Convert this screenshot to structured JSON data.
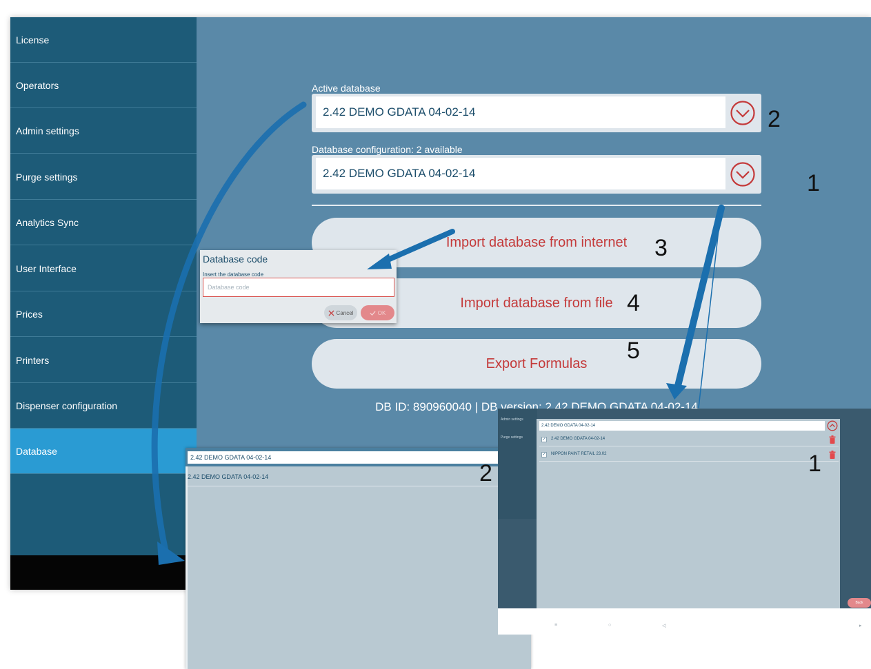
{
  "sidebar": {
    "items": [
      {
        "label": "License"
      },
      {
        "label": "Operators"
      },
      {
        "label": "Admin settings"
      },
      {
        "label": "Purge settings"
      },
      {
        "label": "Analytics Sync"
      },
      {
        "label": "User Interface"
      },
      {
        "label": "Prices"
      },
      {
        "label": "Printers"
      },
      {
        "label": "Dispenser configuration"
      },
      {
        "label": "Database"
      }
    ],
    "active": "Database"
  },
  "main": {
    "active_db_label": "Active database",
    "active_db_value": "2.42  DEMO GDATA 04-02-14",
    "config_label": "Database configuration: 2 available",
    "config_value": "2.42  DEMO GDATA 04-02-14",
    "import_internet": "Import database from internet",
    "import_file": "Import database from file",
    "export_formulas": "Export Formulas",
    "db_info": "DB ID: 890960040 | DB version: 2.42  DEMO GDATA 04-02-14"
  },
  "dialog": {
    "title": "Database code",
    "subtitle": "Insert the database code",
    "placeholder": "Database code",
    "cancel_label": "Cancel",
    "ok_label": "OK"
  },
  "panel_active": {
    "value": "2.42  DEMO GDATA 04-02-14",
    "options": [
      "2.42  DEMO GDATA 04-02-14"
    ]
  },
  "panel_config": {
    "sidebar_items": [
      "Admin settings",
      "Purge settings"
    ],
    "value": "2.42  DEMO GDATA 04-02-14",
    "options": [
      {
        "label": "2.42  DEMO GDATA 04-02-14",
        "checked": true
      },
      {
        "label": "NIPPON PAINT RETAIL 23.02",
        "checked": true
      }
    ],
    "back_label": "Back"
  },
  "annotations": {
    "n1_main": "1",
    "n2_main": "2",
    "n3": "3",
    "n4": "4",
    "n5": "5",
    "n1_panel": "1",
    "n2_panel": "2"
  },
  "colors": {
    "main_bg": "#5a89a8",
    "sidebar_bg": "#1d5b78",
    "sidebar_active": "#2a9bd3",
    "button_text": "#c43a3a",
    "chevron": "#c43a3a",
    "arrow": "#1b6fae"
  }
}
